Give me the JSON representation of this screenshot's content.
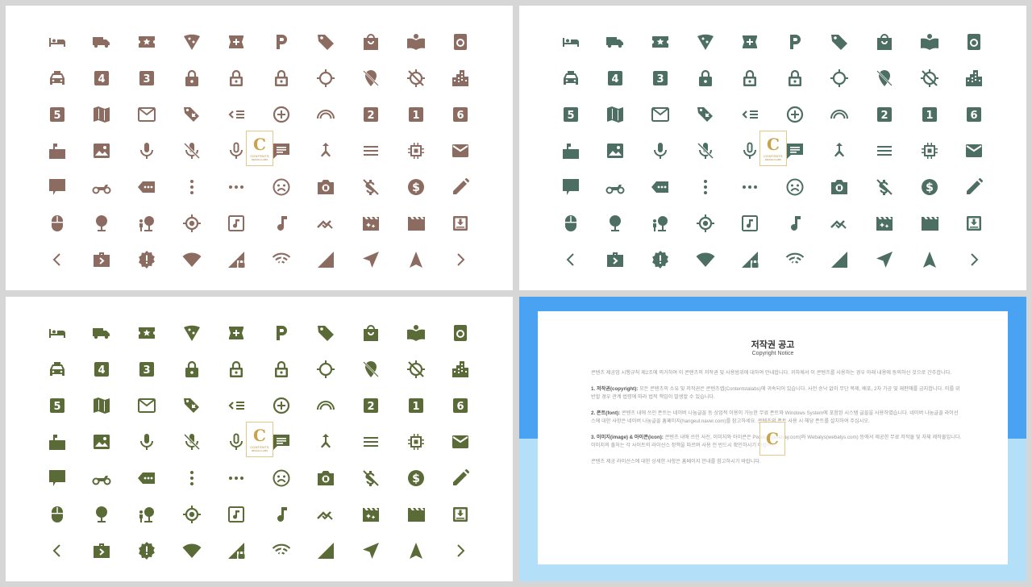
{
  "colors": {
    "brown": "#8c6b60",
    "teal": "#4d6e62",
    "olive": "#5b6b37",
    "blue": "#4aa2f2",
    "light_blue": "#b3dff8"
  },
  "icons": [
    [
      "bed-icon",
      "truck-icon",
      "ticket-star-icon",
      "pizza-icon",
      "pharmacy-icon",
      "parking-icon",
      "tag-icon",
      "shopping-bag-icon",
      "book-location-icon",
      "washing-machine-icon"
    ],
    [
      "taxi-icon",
      "number-4-icon",
      "number-3-icon",
      "lock-icon",
      "lock-open-icon",
      "lock-outline-icon",
      "crosshair-icon",
      "location-off-icon",
      "gps-off-icon",
      "city-icon"
    ],
    [
      "number-5-icon",
      "map-icon",
      "mail-icon",
      "tags-icon",
      "list-arrow-icon",
      "add-circle-icon",
      "arc-icon",
      "number-2-icon",
      "number-1-icon",
      "number-6-icon"
    ],
    [
      "mailbox-icon",
      "image-icon",
      "microphone-icon",
      "microphone-off-icon",
      "microphone-outline-icon",
      "chat-icon",
      "merge-icon",
      "menu-icon",
      "chip-icon",
      "envelope-icon"
    ],
    [
      "comment-icon",
      "motorcycle-icon",
      "label-more-icon",
      "more-vertical-icon",
      "more-horizontal-icon",
      "sad-face-icon",
      "camera-icon",
      "money-off-icon",
      "dollar-circle-icon",
      "pencil-icon"
    ],
    [
      "mouse-icon",
      "tree-icon",
      "nature-people-icon",
      "gps-fixed-icon",
      "music-note-box-icon",
      "music-note-icon",
      "trending-icon",
      "movie-filter-icon",
      "clapperboard-icon",
      "download-box-icon"
    ],
    [
      "chevron-left-icon",
      "work-forward-icon",
      "new-releases-icon",
      "wifi-icon",
      "signal-lock-icon",
      "wifi-off-icon",
      "signal-icon",
      "navigation-icon",
      "navigate-up-icon",
      "chevron-right-icon"
    ]
  ],
  "watermark": {
    "letter": "C",
    "line1": "CONTENTS",
    "line2": "DESIGN LABS"
  },
  "notice": {
    "title": "저작권 공고",
    "subtitle": "Copyright Notice",
    "intro": "콘텐츠 제공업 시행규칙 제2조에 의거하여 이 콘텐츠의 저작권 및 사용범위에 대하여 안내합니다. 귀하께서 이 콘텐츠를 사용하는 경우 아래 내용에 동의하신 것으로 간주합니다.",
    "s1_head": "1. 저작권(copyright):",
    "s1": "모든 콘텐츠의 소유 및 저작권은 콘텐츠랩(Contentstalabs)에 귀속되어 있습니다. 사전 승낙 없이 무단 복제, 배포, 2차 가공 및 재판매를 금지합니다. 이를 위반할 경우 관계 법령에 따라 법적 책임이 발생할 수 있습니다.",
    "s2_head": "2. 폰트(font):",
    "s2": "콘텐츠 내에 쓰인 폰트는 네이버 나눔글꼴 등 상업적 이용이 가능한 무료 폰트와 Windows System에 포함된 시스템 글꼴을 사용하였습니다. 네이버 나눔글꼴 라이선스에 대한 사항은 네이버 나눔글꼴 홈페이지(hangeul.naver.com)를 참고하세요. 콘텐츠의 폰트 사용 시 해당 폰트를 설치하여 주십시오.",
    "s3_head": "3. 이미지(image) & 아이콘(icon):",
    "s3": "콘텐츠 내에 쓰인 사진, 이미지와 아이콘은 Pixabay(pixabay.com)와 Webalys(webalys.com) 등에서 제공한 무료 저작물 및 자체 제작물입니다. 이미지의 출처는 각 사이트의 라이선스 정책을 따르며 사용 전 반드시 확인하시기 바랍니다.",
    "footer": "콘텐츠 제공 라이선스에 대한 상세한 사항은 홈페이지 안내를 참고하시기 바랍니다."
  }
}
